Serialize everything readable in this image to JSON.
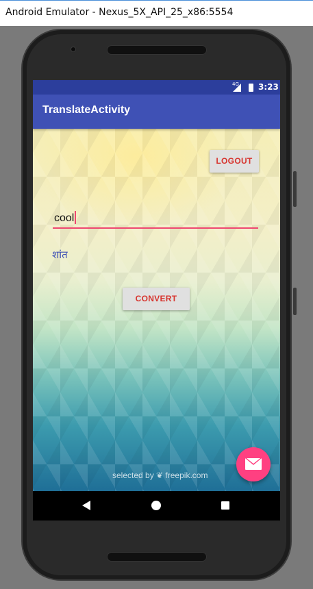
{
  "window": {
    "title": "Android Emulator - Nexus_5X_API_25_x86:5554"
  },
  "status_bar": {
    "network": "4G",
    "time": "3:23"
  },
  "app_bar": {
    "title": "TranslateActivity"
  },
  "main": {
    "logout_label": "LOGOUT",
    "input_value": "cool",
    "translation": "शांत",
    "convert_label": "CONVERT",
    "credit": "selected by ❦ freepik.com"
  },
  "fab": {
    "icon": "email-icon",
    "color": "#ff4081"
  },
  "navigation": {
    "icons": [
      "back-icon",
      "home-icon",
      "recents-icon"
    ]
  },
  "colors": {
    "primary": "#3f51b5",
    "primary_dark": "#2c3e9c",
    "accent": "#ff4081",
    "button_text": "#d7352f"
  }
}
